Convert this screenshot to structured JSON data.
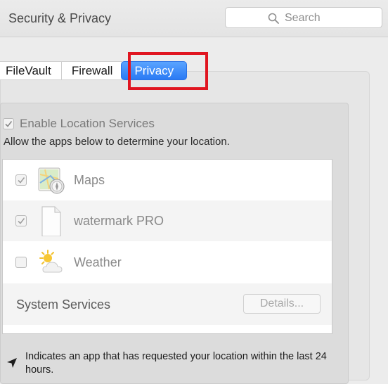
{
  "window": {
    "title": "Security & Privacy",
    "search_placeholder": "Search"
  },
  "tabs": [
    {
      "label": "FileVault",
      "active": false
    },
    {
      "label": "Firewall",
      "active": false
    },
    {
      "label": "Privacy",
      "active": true
    }
  ],
  "location": {
    "enable_label": "Enable Location Services",
    "enable_checked": true,
    "description": "Allow the apps below to determine your location."
  },
  "apps": [
    {
      "name": "Maps",
      "checked": true,
      "icon": "maps-icon"
    },
    {
      "name": "watermark PRO",
      "checked": true,
      "icon": "document-icon"
    },
    {
      "name": "Weather",
      "checked": false,
      "icon": "weather-icon"
    }
  ],
  "system_services": {
    "label": "System Services",
    "details_button": "Details..."
  },
  "footer": {
    "note": "Indicates an app that has requested your location within the last 24 hours.",
    "icon": "location-arrow-icon"
  },
  "colors": {
    "accent": "#2a7af4",
    "highlight": "#e01520"
  }
}
